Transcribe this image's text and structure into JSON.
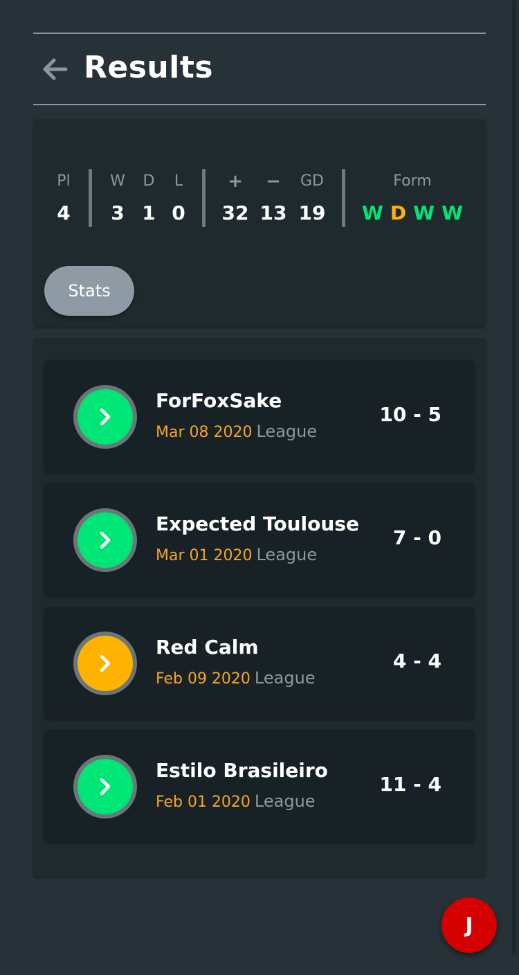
{
  "header": {
    "title": "Results",
    "back_icon": "arrow-left-icon"
  },
  "summary": {
    "played": {
      "label": "Pl",
      "value": "4"
    },
    "wins": {
      "label": "W",
      "value": "3"
    },
    "draws": {
      "label": "D",
      "value": "1"
    },
    "losses": {
      "label": "L",
      "value": "0"
    },
    "goals_for": {
      "label": "+",
      "value": "32"
    },
    "goals_against": {
      "label": "−",
      "value": "13"
    },
    "goal_difference": {
      "label": "GD",
      "value": "19"
    },
    "form": {
      "label": "Form",
      "results": [
        {
          "letter": "W",
          "color": "#00e676"
        },
        {
          "letter": "D",
          "color": "#ffb300"
        },
        {
          "letter": "W",
          "color": "#00e676"
        },
        {
          "letter": "W",
          "color": "#00e676"
        }
      ]
    },
    "stats_button": "Stats"
  },
  "matches": [
    {
      "opponent": "ForFoxSake",
      "date": "Mar 08 2020",
      "competition": "League",
      "score": "10 - 5",
      "result_color": "#00e676"
    },
    {
      "opponent": "Expected Toulouse",
      "date": "Mar 01 2020",
      "competition": "League",
      "score": "7 - 0",
      "result_color": "#00e676"
    },
    {
      "opponent": "Red Calm",
      "date": "Feb 09 2020",
      "competition": "League",
      "score": "4 - 4",
      "result_color": "#ffb300"
    },
    {
      "opponent": "Estilo Brasileiro",
      "date": "Feb 01 2020",
      "competition": "League",
      "score": "11 - 4",
      "result_color": "#00e676"
    }
  ],
  "fab": {
    "label": "J",
    "color": "#d50000"
  },
  "colors": {
    "background": "#263238",
    "card": "#1f2a2f",
    "match_card": "#182226",
    "win": "#00e676",
    "draw": "#ffb300",
    "date": "#f5a623",
    "muted": "#8d989e"
  }
}
